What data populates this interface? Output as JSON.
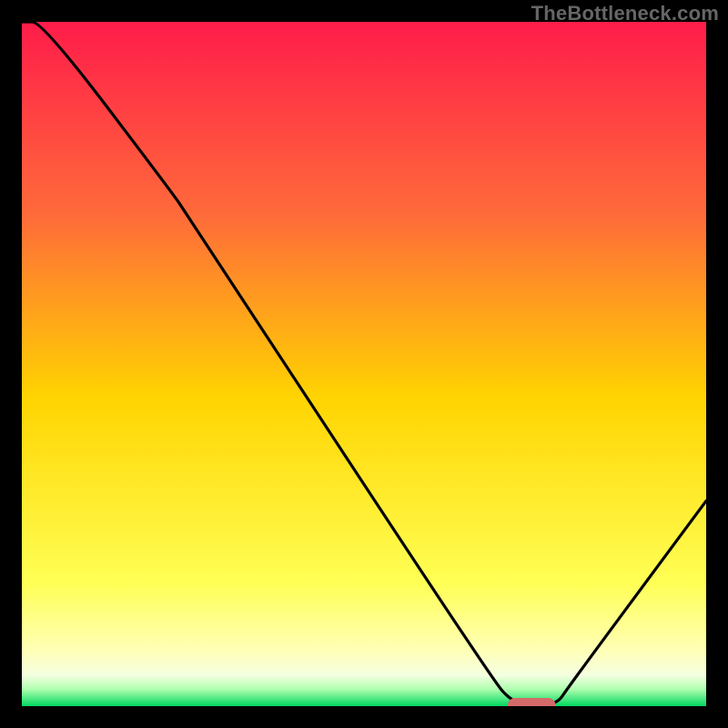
{
  "watermark": "TheBottleneck.com",
  "colors": {
    "background": "#000000",
    "gradient_top": "#ff1c4a",
    "gradient_mid_top": "#ff7a2a",
    "gradient_mid": "#ffd400",
    "gradient_low": "#ffff66",
    "gradient_pale": "#ffffd0",
    "gradient_green": "#00e060",
    "curve": "#000000",
    "marker_fill": "#d46a6a"
  },
  "chart_data": {
    "type": "line",
    "title": "",
    "xlabel": "",
    "ylabel": "",
    "xlim": [
      0,
      100
    ],
    "ylim": [
      0,
      100
    ],
    "x": [
      0,
      3,
      22,
      24,
      68,
      72,
      78,
      80,
      100
    ],
    "values": [
      100,
      100,
      75,
      72,
      5,
      0,
      0,
      3,
      30
    ],
    "marker": {
      "x_start": 71,
      "x_end": 78,
      "y": 0
    }
  }
}
